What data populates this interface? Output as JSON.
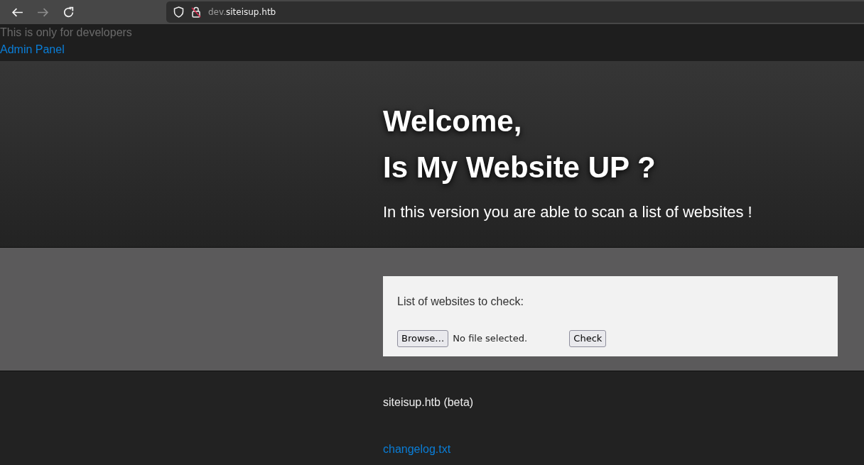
{
  "browser": {
    "nav_buttons": [
      {
        "kind": "back",
        "disabled": false
      },
      {
        "kind": "forward",
        "disabled": true
      },
      {
        "kind": "reload",
        "disabled": false
      }
    ],
    "url": {
      "subdomain": "dev.",
      "domain": "siteisup.htb"
    }
  },
  "dev_notice": "This is only for developers",
  "admin_link": "Admin Panel",
  "hero": {
    "title_lines": [
      "Welcome,",
      "Is My Website UP ?"
    ],
    "subtitle": "In this version you are able to scan a list of websites !"
  },
  "form": {
    "label": "List of websites to check:",
    "file_button": "Browse…",
    "file_status": "No file selected.",
    "submit": "Check"
  },
  "footer": {
    "text": "siteisup.htb (beta)",
    "link": "changelog.txt"
  }
}
